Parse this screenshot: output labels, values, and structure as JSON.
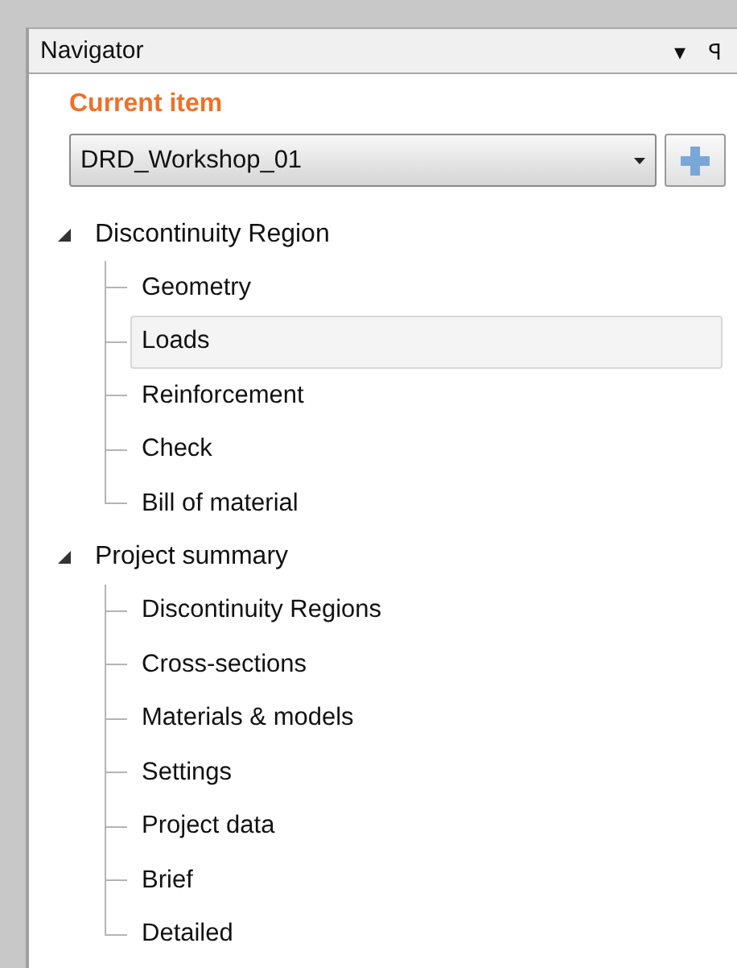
{
  "panel": {
    "title": "Navigator",
    "menu_glyph": "▾",
    "pin_glyph": "ꟼ"
  },
  "current_item": {
    "label": "Current item",
    "value": "DRD_Workshop_01"
  },
  "tree": [
    {
      "label": "Discontinuity Region",
      "expanded": true,
      "children": [
        {
          "label": "Geometry",
          "selected": false
        },
        {
          "label": "Loads",
          "selected": true
        },
        {
          "label": "Reinforcement",
          "selected": false
        },
        {
          "label": "Check",
          "selected": false
        },
        {
          "label": "Bill of material",
          "selected": false
        }
      ]
    },
    {
      "label": "Project summary",
      "expanded": true,
      "children": [
        {
          "label": "Discontinuity Regions",
          "selected": false
        },
        {
          "label": "Cross-sections",
          "selected": false
        },
        {
          "label": "Materials & models",
          "selected": false
        },
        {
          "label": "Settings",
          "selected": false
        },
        {
          "label": "Project data",
          "selected": false
        },
        {
          "label": "Brief",
          "selected": false
        },
        {
          "label": "Detailed",
          "selected": false
        }
      ]
    }
  ]
}
